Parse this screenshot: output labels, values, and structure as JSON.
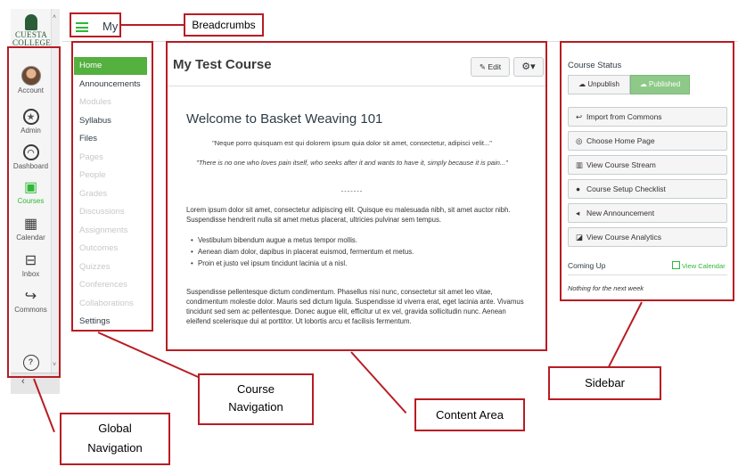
{
  "global_nav": {
    "logo_text": "CUESTA COLLEGE",
    "items": [
      {
        "label": "Account",
        "icon": "avatar"
      },
      {
        "label": "Admin",
        "icon": "shield-icon"
      },
      {
        "label": "Dashboard",
        "icon": "speedometer-icon"
      },
      {
        "label": "Courses",
        "icon": "book-icon"
      },
      {
        "label": "Calendar",
        "icon": "calendar-icon"
      },
      {
        "label": "Inbox",
        "icon": "inbox-icon"
      },
      {
        "label": "Commons",
        "icon": "commons-arrow-icon"
      }
    ],
    "help_icon": "question-circle-icon",
    "collapse_icon": "chevron-left-icon"
  },
  "header": {
    "breadcrumb": "My"
  },
  "course_nav": {
    "items": [
      {
        "label": "Home",
        "state": "active"
      },
      {
        "label": "Announcements",
        "state": "visible"
      },
      {
        "label": "Modules",
        "state": "hidden"
      },
      {
        "label": "Syllabus",
        "state": "visible"
      },
      {
        "label": "Files",
        "state": "visible"
      },
      {
        "label": "Pages",
        "state": "hidden"
      },
      {
        "label": "People",
        "state": "hidden"
      },
      {
        "label": "Grades",
        "state": "hidden"
      },
      {
        "label": "Discussions",
        "state": "hidden"
      },
      {
        "label": "Assignments",
        "state": "hidden"
      },
      {
        "label": "Outcomes",
        "state": "hidden"
      },
      {
        "label": "Quizzes",
        "state": "hidden"
      },
      {
        "label": "Conferences",
        "state": "hidden"
      },
      {
        "label": "Collaborations",
        "state": "hidden"
      },
      {
        "label": "Settings",
        "state": "visible"
      }
    ]
  },
  "content": {
    "title": "My Test Course",
    "edit_label": "Edit",
    "gear_label": "⚙▾",
    "welcome": "Welcome to Basket Weaving 101",
    "quote1": "\"Neque porro quisquam est qui dolorem ipsum quia dolor sit amet, consectetur, adipisci velit...\"",
    "quote2": "\"There is no one who loves pain itself, who seeks after it and wants to have it, simply because it is pain...\"",
    "separator": "-------",
    "para1": "Lorem ipsum dolor sit amet, consectetur adipiscing elit. Quisque eu malesuada nibh, sit amet auctor nibh. Suspendisse hendrerit nulla sit amet metus placerat, ultricies pulvinar sem tempus.",
    "bullets": [
      "Vestibulum bibendum augue a metus tempor mollis.",
      "Aenean diam dolor, dapibus in placerat euismod, fermentum et metus.",
      "Proin et justo vel ipsum tincidunt lacinia ut a nisl."
    ],
    "para2": "Suspendisse pellentesque dictum condimentum. Phasellus nisi nunc, consectetur sit amet leo vitae, condimentum molestie dolor. Mauris sed dictum ligula. Suspendisse id viverra erat, eget lacinia ante. Vivamus tincidunt sed sem ac pellentesque. Donec augue elit, efficitur ut ex vel, gravida sollicitudin nunc. Aenean eleifend scelerisque dui at porttitor. Ut lobortis arcu et facilisis fermentum."
  },
  "sidebar": {
    "course_status": "Course Status",
    "unpublish": "Unpublish",
    "published": "Published",
    "buttons": [
      {
        "label": "Import from Commons",
        "icon": "import-icon"
      },
      {
        "label": "Choose Home Page",
        "icon": "target-icon"
      },
      {
        "label": "View Course Stream",
        "icon": "bar-chart-icon"
      },
      {
        "label": "Course Setup Checklist",
        "icon": "question-circle-icon"
      },
      {
        "label": "New Announcement",
        "icon": "megaphone-icon"
      },
      {
        "label": "View Course Analytics",
        "icon": "line-chart-icon"
      }
    ],
    "coming_up": "Coming Up",
    "view_calendar": "View Calendar",
    "nothing_next": "Nothing for the next week"
  },
  "annotations": {
    "breadcrumbs": "Breadcrumbs",
    "course_nav_1": "Course",
    "course_nav_2": "Navigation",
    "content_area": "Content Area",
    "sidebar": "Sidebar",
    "global_nav_1": "Global",
    "global_nav_2": "Navigation"
  },
  "colors": {
    "accent_green": "#2fb838",
    "home_active": "#54b03f",
    "published": "#8ec98a",
    "annotation_red": "#b81c23",
    "logo_green": "#2a5d37"
  }
}
